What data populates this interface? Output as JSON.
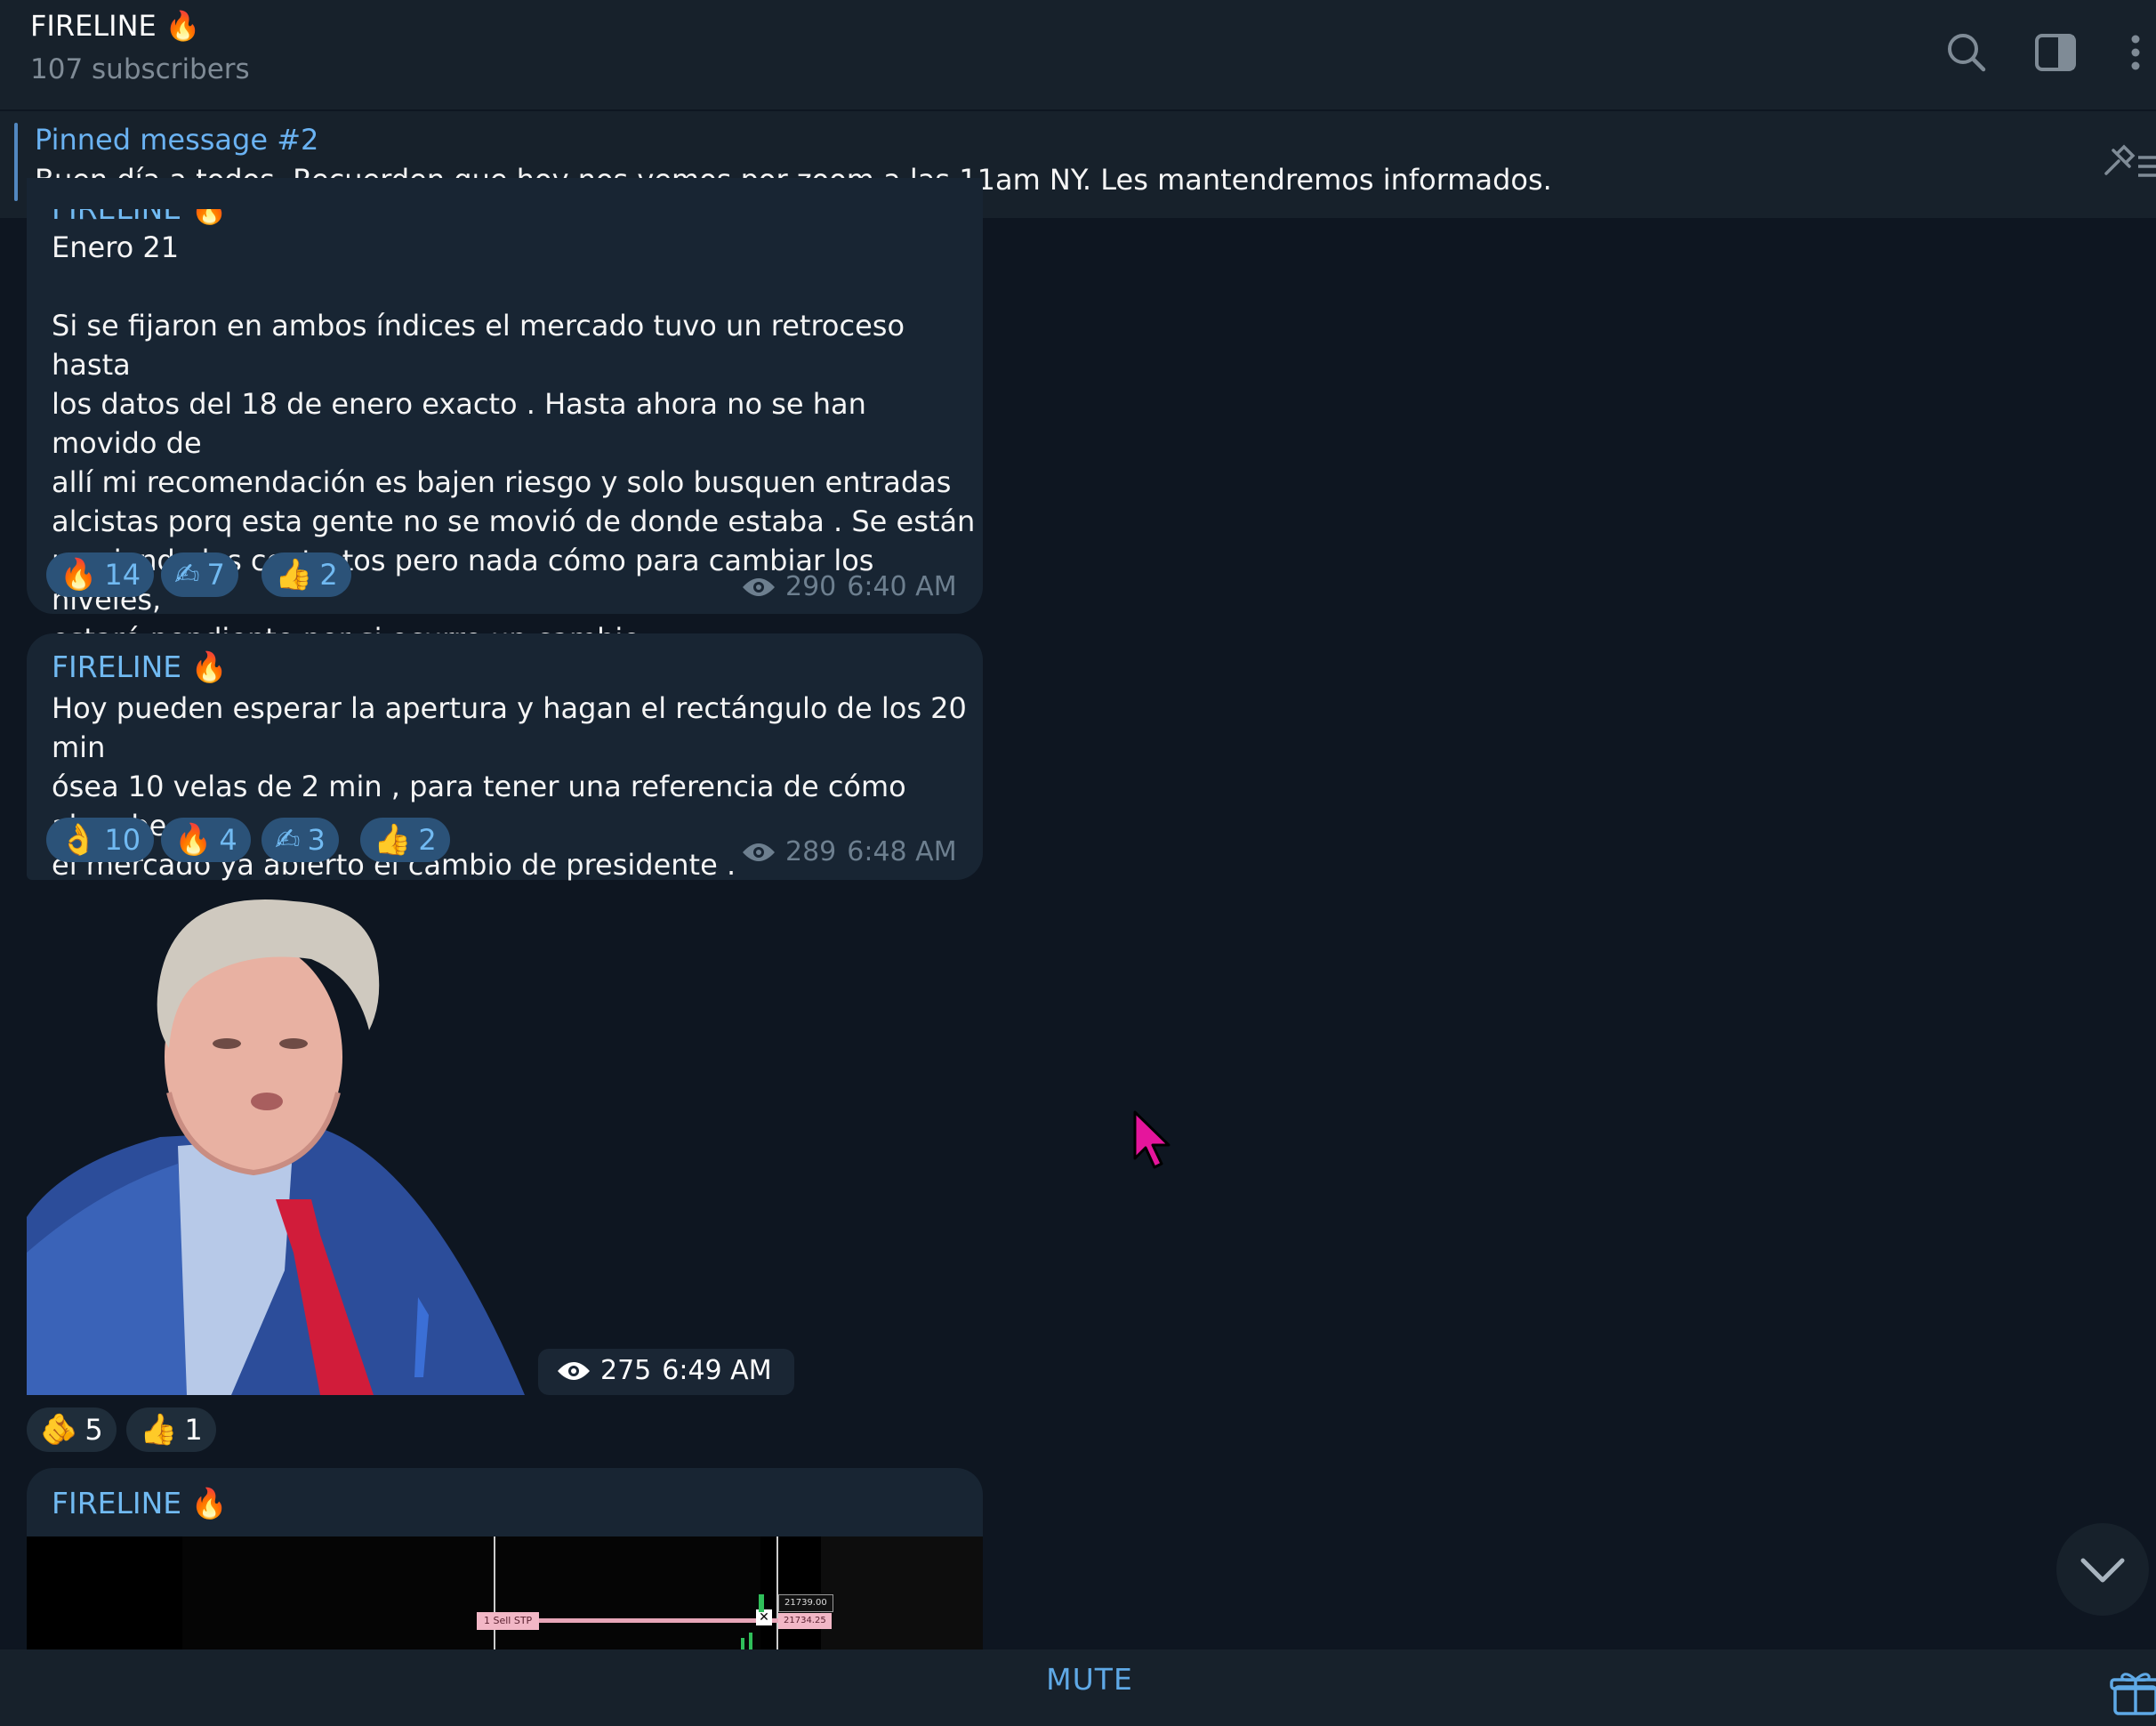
{
  "header": {
    "title": "FIRELINE 🔥",
    "subtitle": "107 subscribers"
  },
  "pinned": {
    "label": "Pinned message #2",
    "text": "Buen día a todos. Recuerden que hoy nos vemos por zoom a las 11am NY. Les mantendremos informados."
  },
  "messages": [
    {
      "partial_sender": "FIRELINE 🔥",
      "text": "Enero 21\n\nSi se fijaron en ambos índices el mercado tuvo un retroceso hasta\nlos datos del 18 de enero exacto . Hasta ahora no se han movido de\nallí mi recomendación es bajen riesgo y solo busquen entradas\nalcistas porq esta gente no se movió de donde estaba . Se están\nmoviendo los contratos pero nada cómo para cambiar los niveles,\nestaré pendiente por si ocurre un cambio .",
      "reactions": [
        {
          "emoji": "🔥",
          "count": "14"
        },
        {
          "emoji": "✍",
          "count": "7"
        },
        {
          "emoji": "👍",
          "count": "2"
        }
      ],
      "views": "290",
      "time": "6:40 AM"
    },
    {
      "sender": "FIRELINE 🔥",
      "text": "Hoy pueden esperar la apertura y hagan el rectángulo de los 20 min\nósea 10 velas de 2 min , para tener una referencia de cómo absorbe\nel mercado ya abierto el cambio de presidente .",
      "reactions": [
        {
          "emoji": "👌",
          "count": "10"
        },
        {
          "emoji": "🔥",
          "count": "4"
        },
        {
          "emoji": "✍",
          "count": "3"
        },
        {
          "emoji": "👍",
          "count": "2"
        }
      ],
      "views": "289",
      "time": "6:48 AM"
    },
    {
      "type": "sticker",
      "sticker_desc": "person-sticker",
      "views": "275",
      "time": "6:49 AM",
      "reactions": [
        {
          "emoji": "🫵",
          "count": "5"
        },
        {
          "emoji": "👍",
          "count": "1"
        }
      ]
    },
    {
      "sender": "FIRELINE 🔥",
      "chart_labels": {
        "order": "1 Sell STP",
        "price_top": "21739.00",
        "price_mid": "21734.25"
      }
    }
  ],
  "footer": {
    "mute_label": "MUTE"
  },
  "colors": {
    "background": "#0e1621",
    "header": "#17212b",
    "bubble": "#182533",
    "accent": "#6ab2f2",
    "cursor": "#e5159c"
  },
  "icons": [
    "search-icon",
    "sidebar-toggle-icon",
    "more-vertical-icon",
    "pin-list-icon",
    "chevron-down-icon",
    "gift-icon",
    "eye-icon",
    "cursor-icon"
  ]
}
